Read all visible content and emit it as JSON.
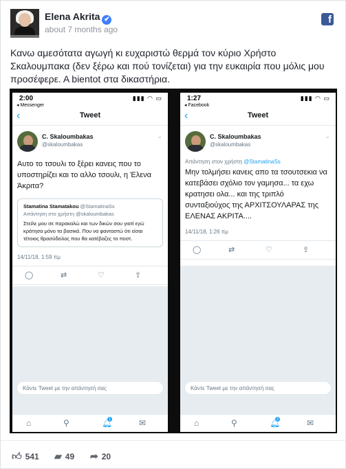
{
  "post": {
    "author": "Elena Akrita",
    "verified_mark": "✔",
    "time": "about 7 months ago",
    "network_icon": "f",
    "text": "Κανω αμεσότατα αγωγή κι ευχαριστώ θερμά τον κύριο Χρήστο Σκαλουμπακα (δεν ξέρω και πού τονίζεται) για την ευκαιρία που μόλις μου προσέφερε. Α bientot στα δικαστήρια."
  },
  "left_phone": {
    "clock": "2:00",
    "back_label": "◂ Messenger",
    "status_icons": "▮▮▮ ◠ ▭",
    "nav_title": "Tweet",
    "author_name": "C. Skaloumbakas",
    "author_handle": "@skaloumbakas",
    "tweet_text": "Αυτο το τσουλι το ξέρει κανεις που το υποστηρίζει και το αλλο τσουλι, η Έλενα Άκριτα?",
    "quote": {
      "name": "Stamatina Stamatakou",
      "handle": "@StamatinaSs",
      "reply_to": "Απάντηση στο χρήστη @skaloumbakas",
      "text": "Στείλε μου σε παρακαλώ και των δικών σου γιατί εγώ κράτησα μόνο τα βασικά. Που να φανταστώ ότι είσαι τέτοιος θρασύδειλος που θα κατέβαζες το ποστ."
    },
    "date": "14/11/18, 1:59 πμ",
    "reply_placeholder": "Κάντε Tweet με την απάντησή σας",
    "badge": "1"
  },
  "right_phone": {
    "clock": "1:27",
    "back_label": "◂ Facebook",
    "status_icons": "▮▮▮ ◠ ▭",
    "nav_title": "Tweet",
    "author_name": "C. Skaloumbakas",
    "author_handle": "@skaloumbakas",
    "reply_prefix": "Απάντηση στον χρήστη ",
    "reply_handle": "@StamatinaSs",
    "tweet_text": "Μην τολμήσει κανεις απο τα τσουτσεκια να κατεβάσει σχόλιο τον γαμησα... τα εχω κρατησει ολα... και της τριπλό συνταξιούχος της ΑΡΧΙΤΣΟΥΛΑΡΑΣ της ΕΛΕΝΑΣ ΑΚΡΙΤΑ....",
    "date": "14/11/18, 1:26 πμ",
    "reply_placeholder": "Κάντε Tweet με την απάντησή σας",
    "badge": "2"
  },
  "footer": {
    "likes": "541",
    "comments": "49",
    "shares": "20"
  },
  "icons": {
    "like": "like-icon",
    "comment": "comment-icon",
    "share": "share-icon"
  }
}
